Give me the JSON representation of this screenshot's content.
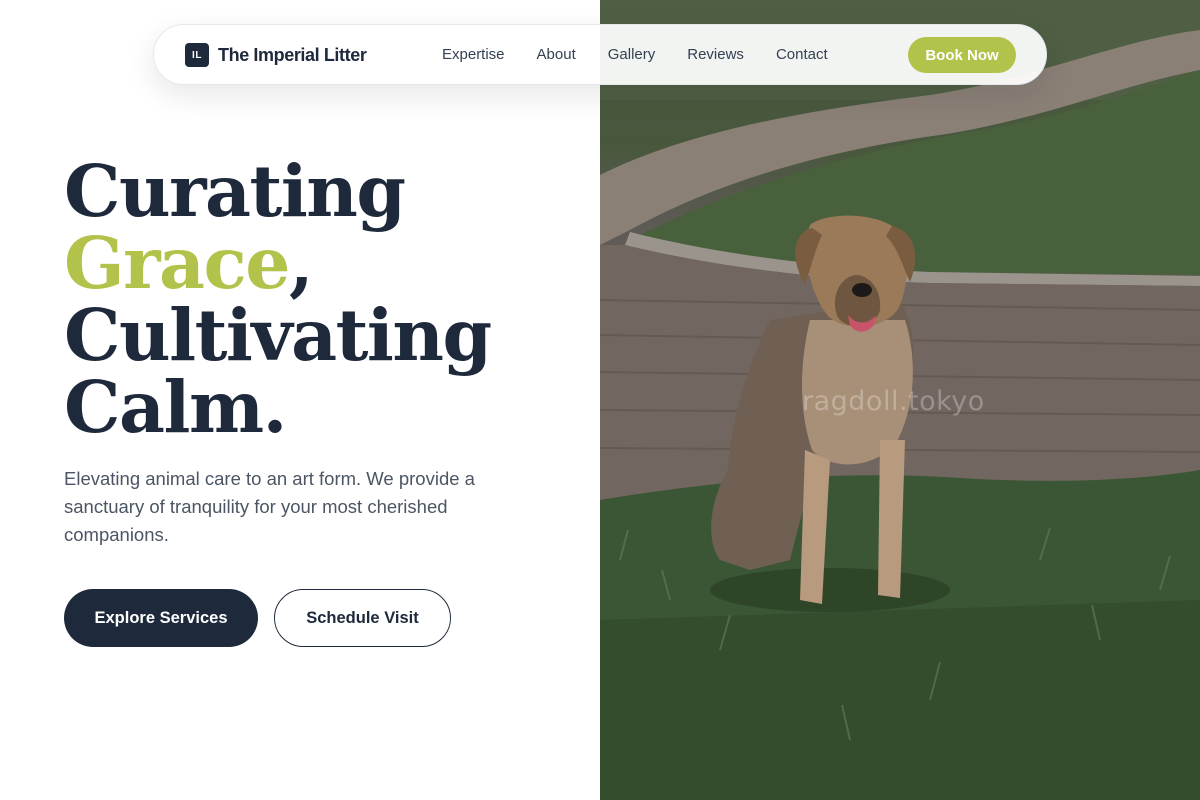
{
  "brand": {
    "mark": "IL",
    "name": "The Imperial Litter"
  },
  "nav": {
    "links": [
      "Expertise",
      "About",
      "Gallery",
      "Reviews",
      "Contact"
    ],
    "cta": "Book Now"
  },
  "hero": {
    "headline_1": "Curating",
    "headline_accent": "Grace",
    "headline_comma": ",",
    "headline_3": "Cultivating",
    "headline_4": "Calm.",
    "description": "Elevating animal care to an art form. We provide a sanctuary of tranquility for your most cherished companions.",
    "primary_button": "Explore Services",
    "secondary_button": "Schedule Visit"
  },
  "image": {
    "watermark": "ragdoll.tokyo",
    "subject": "dog sitting on grass beside a brick path"
  },
  "colors": {
    "navy": "#1e293b",
    "accent": "#b3c24a",
    "body_text": "#4b5563",
    "background": "#ffffff"
  }
}
